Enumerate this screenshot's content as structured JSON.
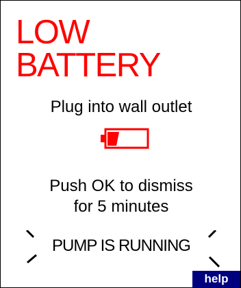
{
  "alert": {
    "title_line1": "LOW",
    "title_line2": "BATTERY",
    "instruction": "Plug into wall outlet",
    "dismiss_line1": "Push OK to dismiss",
    "dismiss_line2": "for 5 minutes"
  },
  "status": {
    "text": "PUMP IS RUNNING"
  },
  "actions": {
    "help_label": "help"
  },
  "icons": {
    "battery": "low-battery-icon",
    "running": "running-indicator-icon"
  },
  "colors": {
    "alert": "#ff0000",
    "text": "#000000",
    "help_button": "#00007f",
    "background": "#ffffff"
  }
}
